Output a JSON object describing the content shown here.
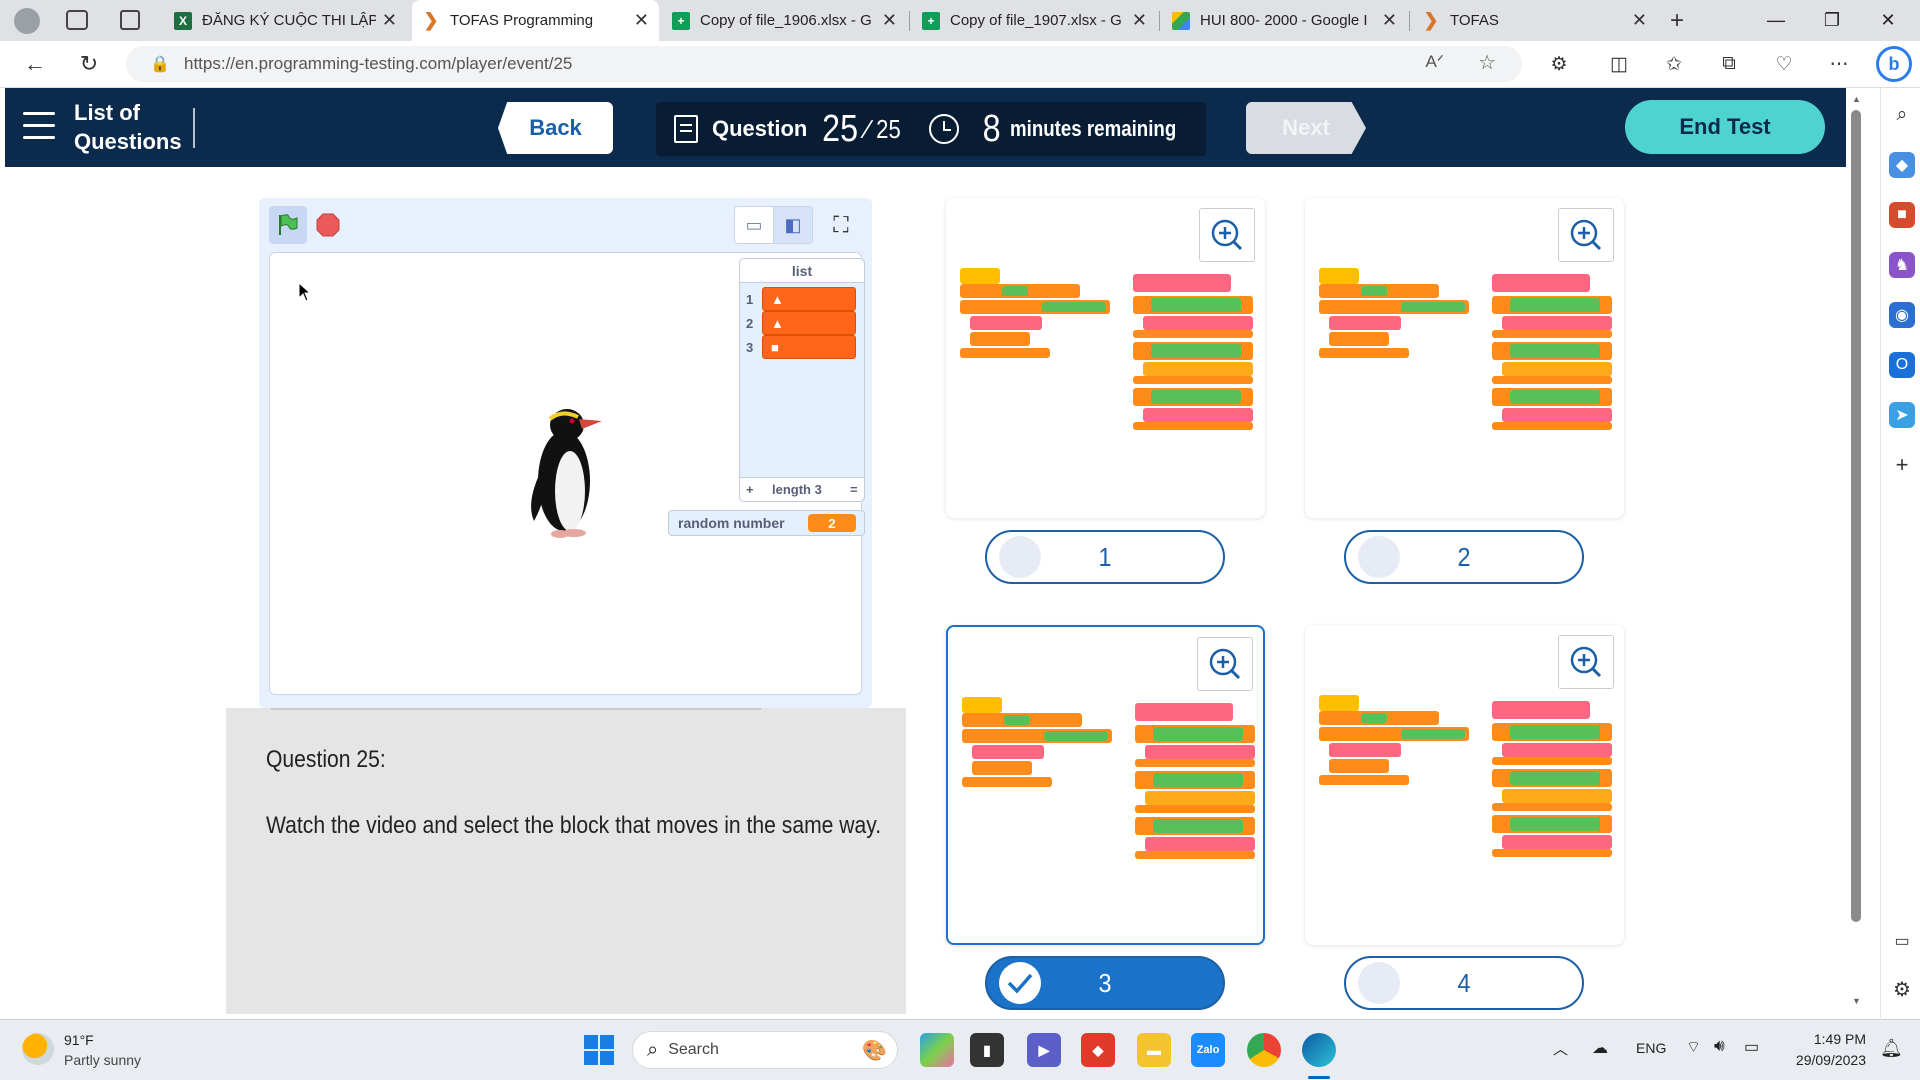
{
  "browser": {
    "tabs": [
      {
        "label": "ĐĂNG KÝ CUỘC THI LẬP",
        "icon": "excel-icon"
      },
      {
        "label": "TOFAS Programming",
        "icon": "tofas-icon",
        "active": true
      },
      {
        "label": "Copy of file_1906.xlsx - G",
        "icon": "sheets-icon"
      },
      {
        "label": "Copy of file_1907.xlsx - G",
        "icon": "sheets-icon"
      },
      {
        "label": "HUI 800- 2000 - Google I",
        "icon": "drive-icon"
      },
      {
        "label": "TOFAS",
        "icon": "tofas-icon"
      }
    ],
    "url": "https://en.programming-testing.com/player/event/25"
  },
  "header": {
    "list_title": "List of Questions",
    "back_label": "Back",
    "question_label": "Question",
    "question_current": "25",
    "question_total": "25",
    "minutes": "8",
    "minutes_label": "minutes remaining",
    "next_label": "Next",
    "end_label": "End Test",
    "colors": {
      "bar": "#0c2b4c",
      "end": "#4fd3d0",
      "next_disabled": "#d9dde3"
    }
  },
  "player": {
    "list_monitor": {
      "title": "list",
      "items": [
        {
          "index": "1",
          "value": "▲"
        },
        {
          "index": "2",
          "value": "▲"
        },
        {
          "index": "3",
          "value": "■"
        }
      ],
      "add": "+",
      "length_label": "length 3",
      "resize": "="
    },
    "variable_monitor": {
      "label": "random number",
      "value": "2"
    }
  },
  "question": {
    "label": "Question 25:",
    "text": "Watch the video and select the block that moves in the same way."
  },
  "options": [
    {
      "number": "1",
      "selected": false
    },
    {
      "number": "2",
      "selected": false
    },
    {
      "number": "3",
      "selected": true
    },
    {
      "number": "4",
      "selected": false
    }
  ],
  "taskbar": {
    "weather_temp": "91°F",
    "weather_desc": "Partly sunny",
    "search_label": "Search",
    "language": "ENG",
    "time": "1:49 PM",
    "date": "29/09/2023"
  }
}
